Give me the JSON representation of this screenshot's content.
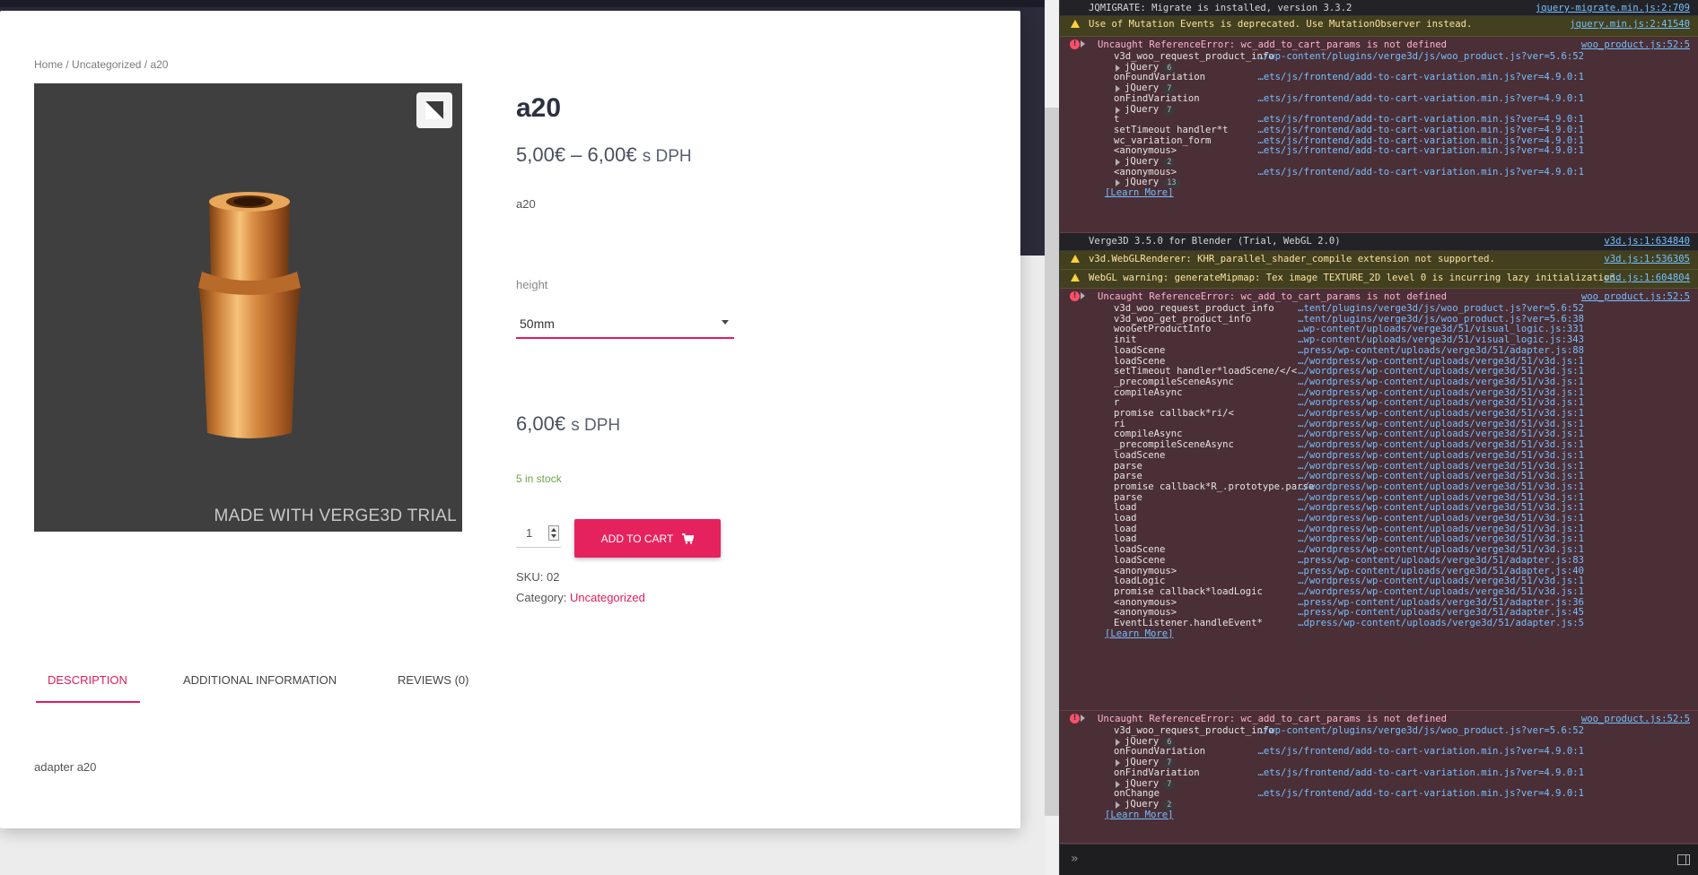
{
  "page": {
    "breadcrumb": {
      "home": "Home",
      "sep1": " / ",
      "category": "Uncategorized",
      "sep2": " / ",
      "current": "a20"
    },
    "viewer": {
      "watermark": "MADE WITH VERGE3D TRIAL",
      "fullscreen_icon": "fullscreen-icon",
      "background": "#3f3f3f"
    },
    "product": {
      "title": "a20",
      "price_range": "5,00€ – 6,00€",
      "price_suffix": "s DPH",
      "short_description": "a20",
      "variation_label": "height",
      "variation_value": "50mm",
      "price_single": "6,00€",
      "stock": "5 in stock",
      "quantity": "1",
      "add_to_cart_label": "ADD TO CART",
      "sku_label": "SKU:",
      "sku_value": "02",
      "category_label": "Category:",
      "category_value": "Uncategorized"
    },
    "tabs": [
      {
        "label": "DESCRIPTION",
        "active": true
      },
      {
        "label": "ADDITIONAL INFORMATION",
        "active": false
      },
      {
        "label": "REVIEWS (0)",
        "active": false
      }
    ],
    "description_content": "adapter a20",
    "colors": {
      "accent": "#e6225e",
      "stock": "#6aa548",
      "title": "#2b3140"
    }
  },
  "console": {
    "messages": {
      "m1": {
        "type": "log",
        "text": "JQMIGRATE: Migrate is installed, version 3.3.2",
        "src": "jquery-migrate.min.js:2:709"
      },
      "m2": {
        "type": "warn",
        "text": "Use of Mutation Events is deprecated. Use MutationObserver instead.",
        "src": "jquery.min.js:2:41540"
      },
      "m3": {
        "type": "error",
        "text": "Uncaught ReferenceError: wc_add_to_cart_params is not defined",
        "src": "woo_product.js:52:5",
        "frames": [
          {
            "fn": "v3d_woo_request_product_info",
            "loc": "…/wp-content/plugins/verge3d/js/woo_product.js?ver=5.6:52"
          },
          {
            "fn": "jQuery",
            "badge": "6",
            "group": true
          },
          {
            "fn": "onFoundVariation",
            "loc": "…ets/js/frontend/add-to-cart-variation.min.js?ver=4.9.0:1"
          },
          {
            "fn": "jQuery",
            "badge": "7",
            "group": true
          },
          {
            "fn": "onFindVariation",
            "loc": "…ets/js/frontend/add-to-cart-variation.min.js?ver=4.9.0:1"
          },
          {
            "fn": "jQuery",
            "badge": "7",
            "group": true
          },
          {
            "fn": "t",
            "loc": "…ets/js/frontend/add-to-cart-variation.min.js?ver=4.9.0:1"
          },
          {
            "fn": "setTimeout handler*t",
            "loc": "…ets/js/frontend/add-to-cart-variation.min.js?ver=4.9.0:1"
          },
          {
            "fn": "wc_variation_form",
            "loc": "…ets/js/frontend/add-to-cart-variation.min.js?ver=4.9.0:1"
          },
          {
            "fn": "<anonymous>",
            "loc": "…ets/js/frontend/add-to-cart-variation.min.js?ver=4.9.0:1"
          },
          {
            "fn": "jQuery",
            "badge": "2",
            "group": true
          },
          {
            "fn": "<anonymous>",
            "loc": "…ets/js/frontend/add-to-cart-variation.min.js?ver=4.9.0:1"
          },
          {
            "fn": "jQuery",
            "badge": "13",
            "group": true
          }
        ],
        "learn_more": "[Learn More]"
      },
      "m4": {
        "type": "log",
        "text": "Verge3D 3.5.0 for Blender (Trial, WebGL 2.0)",
        "src": "v3d.js:1:634840"
      },
      "m5": {
        "type": "warn",
        "text": "v3d.WebGLRenderer: KHR_parallel_shader_compile extension not supported.",
        "src": "v3d.js:1:536305"
      },
      "m6": {
        "type": "warn",
        "text": "WebGL warning: generateMipmap: Tex image TEXTURE_2D level 0 is incurring lazy initialization.",
        "src": "v3d.js:1:604804"
      },
      "m7": {
        "type": "error",
        "text": "Uncaught ReferenceError: wc_add_to_cart_params is not defined",
        "src": "woo_product.js:52:5",
        "frames": [
          {
            "fn": "v3d_woo_request_product_info",
            "loc": "…tent/plugins/verge3d/js/woo_product.js?ver=5.6:52"
          },
          {
            "fn": "v3d_woo_get_product_info",
            "loc": "…tent/plugins/verge3d/js/woo_product.js?ver=5.6:38"
          },
          {
            "fn": "wooGetProductInfo",
            "loc": "…wp-content/uploads/verge3d/51/visual_logic.js:331"
          },
          {
            "fn": "init",
            "loc": "…wp-content/uploads/verge3d/51/visual_logic.js:343"
          },
          {
            "fn": "loadScene",
            "loc": "…press/wp-content/uploads/verge3d/51/adapter.js:88"
          },
          {
            "fn": "loadScene",
            "loc": "…/wordpress/wp-content/uploads/verge3d/51/v3d.js:1"
          },
          {
            "fn": "setTimeout handler*loadScene/</<",
            "loc": "…/wordpress/wp-content/uploads/verge3d/51/v3d.js:1"
          },
          {
            "fn": "_precompileSceneAsync",
            "loc": "…/wordpress/wp-content/uploads/verge3d/51/v3d.js:1"
          },
          {
            "fn": "compileAsync",
            "loc": "…/wordpress/wp-content/uploads/verge3d/51/v3d.js:1"
          },
          {
            "fn": "r",
            "loc": "…/wordpress/wp-content/uploads/verge3d/51/v3d.js:1"
          },
          {
            "fn": "promise callback*ri/<",
            "loc": "…/wordpress/wp-content/uploads/verge3d/51/v3d.js:1"
          },
          {
            "fn": "ri",
            "loc": "…/wordpress/wp-content/uploads/verge3d/51/v3d.js:1"
          },
          {
            "fn": "compileAsync",
            "loc": "…/wordpress/wp-content/uploads/verge3d/51/v3d.js:1"
          },
          {
            "fn": "_precompileSceneAsync",
            "loc": "…/wordpress/wp-content/uploads/verge3d/51/v3d.js:1"
          },
          {
            "fn": "loadScene",
            "loc": "…/wordpress/wp-content/uploads/verge3d/51/v3d.js:1"
          },
          {
            "fn": "parse",
            "loc": "…/wordpress/wp-content/uploads/verge3d/51/v3d.js:1"
          },
          {
            "fn": "parse",
            "loc": "…/wordpress/wp-content/uploads/verge3d/51/v3d.js:1"
          },
          {
            "fn": "promise callback*R_.prototype.parse",
            "loc": "…/wordpress/wp-content/uploads/verge3d/51/v3d.js:1"
          },
          {
            "fn": "parse",
            "loc": "…/wordpress/wp-content/uploads/verge3d/51/v3d.js:1"
          },
          {
            "fn": "load",
            "loc": "…/wordpress/wp-content/uploads/verge3d/51/v3d.js:1"
          },
          {
            "fn": "load",
            "loc": "…/wordpress/wp-content/uploads/verge3d/51/v3d.js:1"
          },
          {
            "fn": "load",
            "loc": "…/wordpress/wp-content/uploads/verge3d/51/v3d.js:1"
          },
          {
            "fn": "load",
            "loc": "…/wordpress/wp-content/uploads/verge3d/51/v3d.js:1"
          },
          {
            "fn": "loadScene",
            "loc": "…/wordpress/wp-content/uploads/verge3d/51/v3d.js:1"
          },
          {
            "fn": "loadScene",
            "loc": "…press/wp-content/uploads/verge3d/51/adapter.js:83"
          },
          {
            "fn": "<anonymous>",
            "loc": "…press/wp-content/uploads/verge3d/51/adapter.js:40"
          },
          {
            "fn": "loadLogic",
            "loc": "…/wordpress/wp-content/uploads/verge3d/51/v3d.js:1"
          },
          {
            "fn": "promise callback*loadLogic",
            "loc": "…/wordpress/wp-content/uploads/verge3d/51/v3d.js:1"
          },
          {
            "fn": "<anonymous>",
            "loc": "…press/wp-content/uploads/verge3d/51/adapter.js:36"
          },
          {
            "fn": "<anonymous>",
            "loc": "…press/wp-content/uploads/verge3d/51/adapter.js:45"
          },
          {
            "fn": "EventListener.handleEvent*",
            "loc": "…dpress/wp-content/uploads/verge3d/51/adapter.js:5"
          }
        ],
        "learn_more": "[Learn More]"
      },
      "m8": {
        "type": "error",
        "text": "Uncaught ReferenceError: wc_add_to_cart_params is not defined",
        "src": "woo_product.js:52:5",
        "frames": [
          {
            "fn": "v3d_woo_request_product_info",
            "loc": "…/wp-content/plugins/verge3d/js/woo_product.js?ver=5.6:52"
          },
          {
            "fn": "jQuery",
            "badge": "6",
            "group": true
          },
          {
            "fn": "onFoundVariation",
            "loc": "…ets/js/frontend/add-to-cart-variation.min.js?ver=4.9.0:1"
          },
          {
            "fn": "jQuery",
            "badge": "7",
            "group": true
          },
          {
            "fn": "onFindVariation",
            "loc": "…ets/js/frontend/add-to-cart-variation.min.js?ver=4.9.0:1"
          },
          {
            "fn": "jQuery",
            "badge": "7",
            "group": true
          },
          {
            "fn": "onChange",
            "loc": "…ets/js/frontend/add-to-cart-variation.min.js?ver=4.9.0:1"
          },
          {
            "fn": "jQuery",
            "badge": "2",
            "group": true
          }
        ],
        "learn_more": "[Learn More]"
      }
    },
    "input_prompt": "»",
    "colors": {
      "error_bg": "#4b2f36",
      "warn_bg": "#42401f",
      "link": "#75bfff"
    }
  }
}
